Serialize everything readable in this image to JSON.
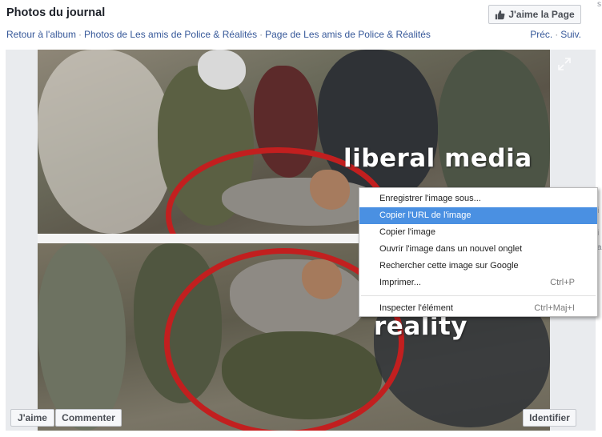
{
  "header": {
    "title": "Photos du journal",
    "like_page_label": "J'aime la Page"
  },
  "breadcrumbs": {
    "items": [
      "Retour à l'album",
      "Photos de Les amis de Police & Réalités",
      "Page de Les amis de Police & Réalités"
    ],
    "separator": "·"
  },
  "pager": {
    "prev": "Préc.",
    "separator": "·",
    "next": "Suiv."
  },
  "photo": {
    "caption_top": "liberal media",
    "caption_bottom": "reality",
    "circle_color": "#c21f1f"
  },
  "actions": {
    "like": "J'aime",
    "comment": "Commenter",
    "tag": "Identifier"
  },
  "context_menu": {
    "items": [
      {
        "label": "Enregistrer l'image sous...",
        "shortcut": ""
      },
      {
        "label": "Copier l'URL de l'image",
        "shortcut": "",
        "active": true
      },
      {
        "label": "Copier l'image",
        "shortcut": ""
      },
      {
        "label": "Ouvrir l'image dans un nouvel onglet",
        "shortcut": ""
      },
      {
        "label": "Rechercher cette image sur Google",
        "shortcut": ""
      },
      {
        "label": "Imprimer...",
        "shortcut": "Ctrl+P"
      }
    ],
    "footer_item": {
      "label": "Inspecter l'élément",
      "shortcut": "Ctrl+Maj+I"
    }
  },
  "edge_glyphs": {
    "g1": "s",
    "g2": "i",
    "g3": "i",
    "g4": "a"
  },
  "colors": {
    "link": "#365899",
    "highlight": "#4a90e2"
  }
}
